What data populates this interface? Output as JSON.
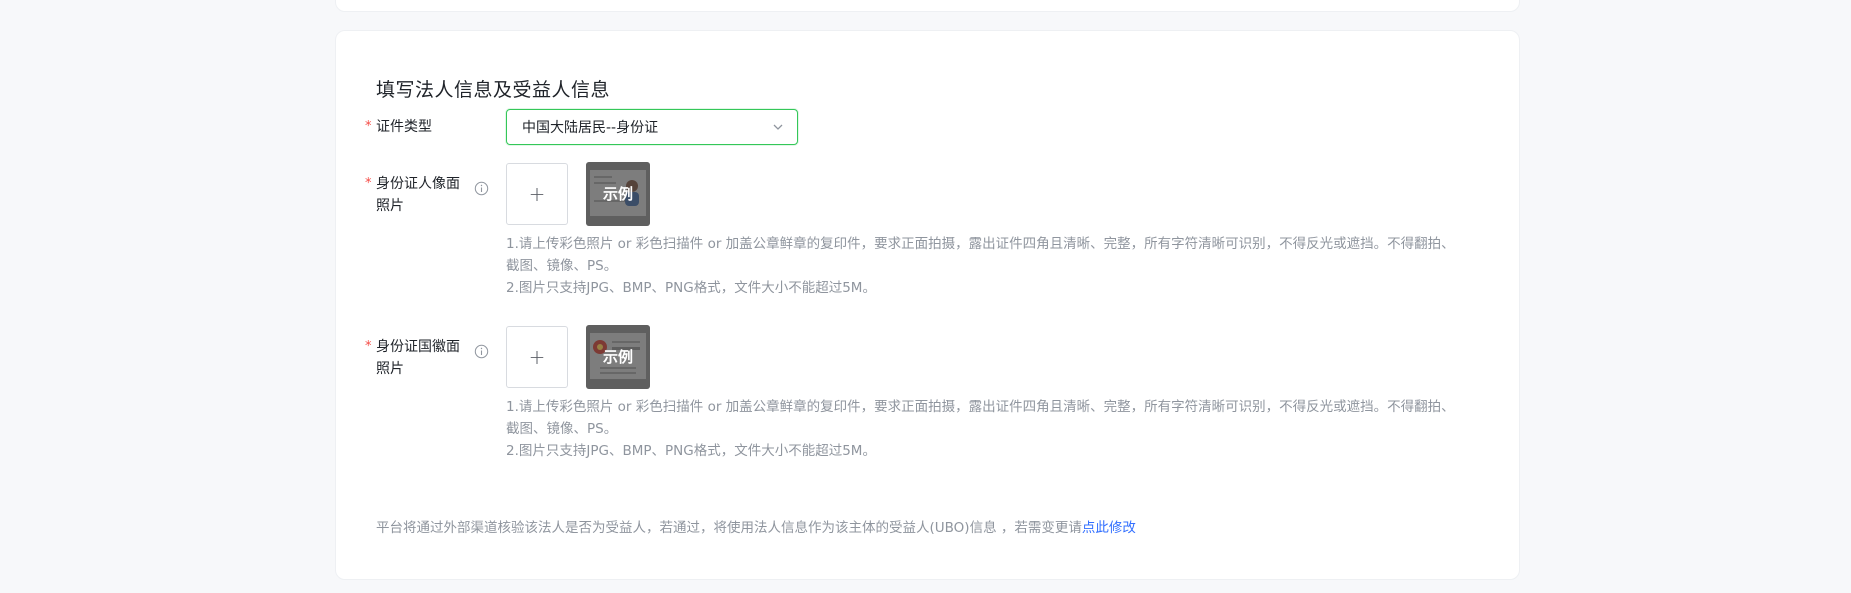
{
  "section": {
    "title": "填写法人信息及受益人信息"
  },
  "form": {
    "required_mark": "*",
    "id_type": {
      "label": "证件类型",
      "value": "中国大陆居民--身份证"
    },
    "id_front": {
      "label": "身份证人像面照片",
      "upload_glyph": "+",
      "sample_label": "示例",
      "hints": [
        "1.请上传彩色照片 or 彩色扫描件 or 加盖公章鲜章的复印件，要求正面拍摄，露出证件四角且清晰、完整，所有字符清晰可识别，不得反光或遮挡。不得翻拍、截图、镜像、PS。",
        "2.图片只支持JPG、BMP、PNG格式，文件大小不能超过5M。"
      ]
    },
    "id_back": {
      "label": "身份证国徽面照片",
      "upload_glyph": "+",
      "sample_label": "示例",
      "hints": [
        "1.请上传彩色照片 or 彩色扫描件 or 加盖公章鲜章的复印件，要求正面拍摄，露出证件四角且清晰、完整，所有字符清晰可识别，不得反光或遮挡。不得翻拍、截图、镜像、PS。",
        "2.图片只支持JPG、BMP、PNG格式，文件大小不能超过5M。"
      ]
    }
  },
  "footer": {
    "note": "平台将通过外部渠道核验该法人是否为受益人，若通过，将使用法人信息作为该主体的受益人(UBO)信息 ，若需变更请",
    "link": "点此修改"
  },
  "colors": {
    "accent_green": "#34c759",
    "required_red": "#f54a45",
    "link_blue": "#3370ff"
  },
  "icons": [
    "info-icon",
    "chevron-down-icon",
    "plus-icon"
  ]
}
